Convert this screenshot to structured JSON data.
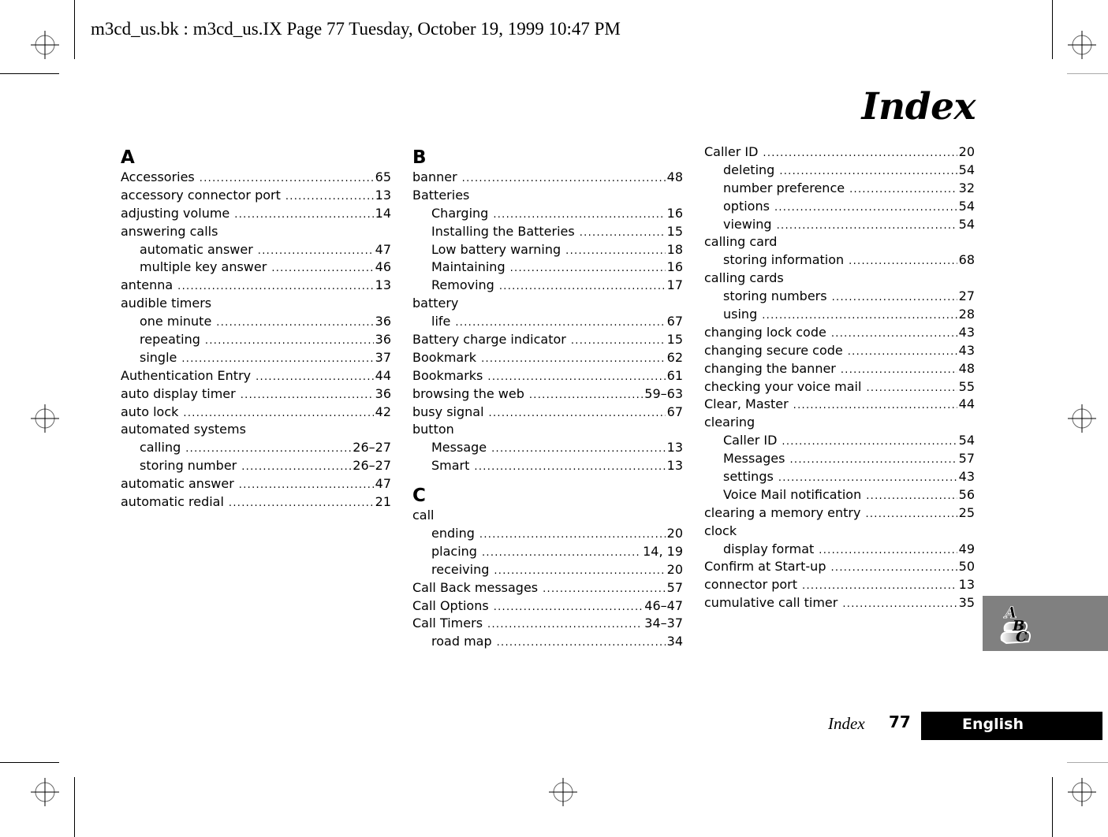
{
  "header": {
    "slug": "m3cd_us.bk : m3cd_us.IX  Page 77  Tuesday, October 19, 1999  10:47 PM"
  },
  "page_title": "Index",
  "columns": [
    {
      "sections": [
        {
          "letter": "A",
          "entries": [
            {
              "term": "Accessories",
              "page": "65",
              "level": 0
            },
            {
              "term": "accessory connector port",
              "page": "13",
              "level": 0
            },
            {
              "term": "adjusting volume",
              "page": "14",
              "level": 0
            },
            {
              "term": "answering calls",
              "page": "",
              "level": 0
            },
            {
              "term": "automatic answer",
              "page": "47",
              "level": 1
            },
            {
              "term": "multiple key answer",
              "page": "46",
              "level": 1
            },
            {
              "term": "antenna",
              "page": "13",
              "level": 0
            },
            {
              "term": "audible timers",
              "page": "",
              "level": 0
            },
            {
              "term": "one minute",
              "page": "36",
              "level": 1
            },
            {
              "term": "repeating",
              "page": "36",
              "level": 1
            },
            {
              "term": "single",
              "page": "37",
              "level": 1
            },
            {
              "term": "Authentication Entry",
              "page": "44",
              "level": 0
            },
            {
              "term": "auto display timer",
              "page": "36",
              "level": 0
            },
            {
              "term": "auto lock",
              "page": "42",
              "level": 0
            },
            {
              "term": "automated systems",
              "page": "",
              "level": 0
            },
            {
              "term": "calling",
              "page": "26–27",
              "level": 1
            },
            {
              "term": "storing number",
              "page": "26–27",
              "level": 1
            },
            {
              "term": "automatic answer",
              "page": "47",
              "level": 0
            },
            {
              "term": "automatic redial",
              "page": "21",
              "level": 0
            }
          ]
        }
      ]
    },
    {
      "sections": [
        {
          "letter": "B",
          "entries": [
            {
              "term": "banner",
              "page": "48",
              "level": 0
            },
            {
              "term": "Batteries",
              "page": "",
              "level": 0
            },
            {
              "term": "Charging",
              "page": "16",
              "level": 1
            },
            {
              "term": "Installing the Batteries",
              "page": "15",
              "level": 1
            },
            {
              "term": "Low battery warning",
              "page": "18",
              "level": 1
            },
            {
              "term": "Maintaining",
              "page": "16",
              "level": 1
            },
            {
              "term": "Removing",
              "page": "17",
              "level": 1
            },
            {
              "term": "battery",
              "page": "",
              "level": 0
            },
            {
              "term": "life",
              "page": "67",
              "level": 1
            },
            {
              "term": "Battery charge indicator",
              "page": "15",
              "level": 0
            },
            {
              "term": "Bookmark",
              "page": "62",
              "level": 0
            },
            {
              "term": "Bookmarks",
              "page": "61",
              "level": 0
            },
            {
              "term": "browsing the web",
              "page": "59–63",
              "level": 0
            },
            {
              "term": "busy signal",
              "page": "67",
              "level": 0
            },
            {
              "term": "button",
              "page": "",
              "level": 0
            },
            {
              "term": "Message",
              "page": "13",
              "level": 1
            },
            {
              "term": "Smart",
              "page": "13",
              "level": 1
            }
          ]
        },
        {
          "letter": "C",
          "entries": [
            {
              "term": "call",
              "page": "",
              "level": 0
            },
            {
              "term": "ending",
              "page": "20",
              "level": 1
            },
            {
              "term": "placing",
              "page": "14, 19",
              "level": 1
            },
            {
              "term": "receiving",
              "page": "20",
              "level": 1
            },
            {
              "term": "Call Back messages",
              "page": "57",
              "level": 0
            },
            {
              "term": "Call Options",
              "page": "46–47",
              "level": 0
            },
            {
              "term": "Call Timers",
              "page": "34–37",
              "level": 0
            },
            {
              "term": "road map",
              "page": "34",
              "level": 1
            }
          ]
        }
      ]
    },
    {
      "sections": [
        {
          "letter": "",
          "entries": [
            {
              "term": "Caller ID",
              "page": "20",
              "level": 0
            },
            {
              "term": "deleting",
              "page": "54",
              "level": 1
            },
            {
              "term": "number preference",
              "page": "32",
              "level": 1
            },
            {
              "term": "options",
              "page": "54",
              "level": 1
            },
            {
              "term": "viewing",
              "page": "54",
              "level": 1
            },
            {
              "term": "calling card",
              "page": "",
              "level": 0
            },
            {
              "term": "storing information",
              "page": "68",
              "level": 1
            },
            {
              "term": "calling cards",
              "page": "",
              "level": 0
            },
            {
              "term": "storing numbers",
              "page": "27",
              "level": 1
            },
            {
              "term": "using",
              "page": "28",
              "level": 1
            },
            {
              "term": "changing lock code",
              "page": "43",
              "level": 0
            },
            {
              "term": "changing secure code",
              "page": "43",
              "level": 0
            },
            {
              "term": "changing the banner",
              "page": "48",
              "level": 0
            },
            {
              "term": "checking your voice mail",
              "page": "55",
              "level": 0
            },
            {
              "term": "Clear, Master",
              "page": "44",
              "level": 0
            },
            {
              "term": "clearing",
              "page": "",
              "level": 0
            },
            {
              "term": "Caller ID",
              "page": "54",
              "level": 1
            },
            {
              "term": "Messages",
              "page": "57",
              "level": 1
            },
            {
              "term": "settings",
              "page": "43",
              "level": 1
            },
            {
              "term": "Voice Mail notification",
              "page": "56",
              "level": 1
            },
            {
              "term": "clearing a memory entry",
              "page": "25",
              "level": 0
            },
            {
              "term": "clock",
              "page": "",
              "level": 0
            },
            {
              "term": "display format",
              "page": "49",
              "level": 1
            },
            {
              "term": "Confirm at Start-up",
              "page": "50",
              "level": 0
            },
            {
              "term": "connector port",
              "page": "13",
              "level": 0
            },
            {
              "term": "cumulative call timer",
              "page": "35",
              "level": 0
            }
          ]
        }
      ]
    }
  ],
  "side_tab": {
    "icon": "abc-index-icon",
    "letters": [
      "A",
      "B",
      "C"
    ],
    "color": "#808080"
  },
  "footer": {
    "section": "Index",
    "page_number": "77",
    "language": "English"
  }
}
